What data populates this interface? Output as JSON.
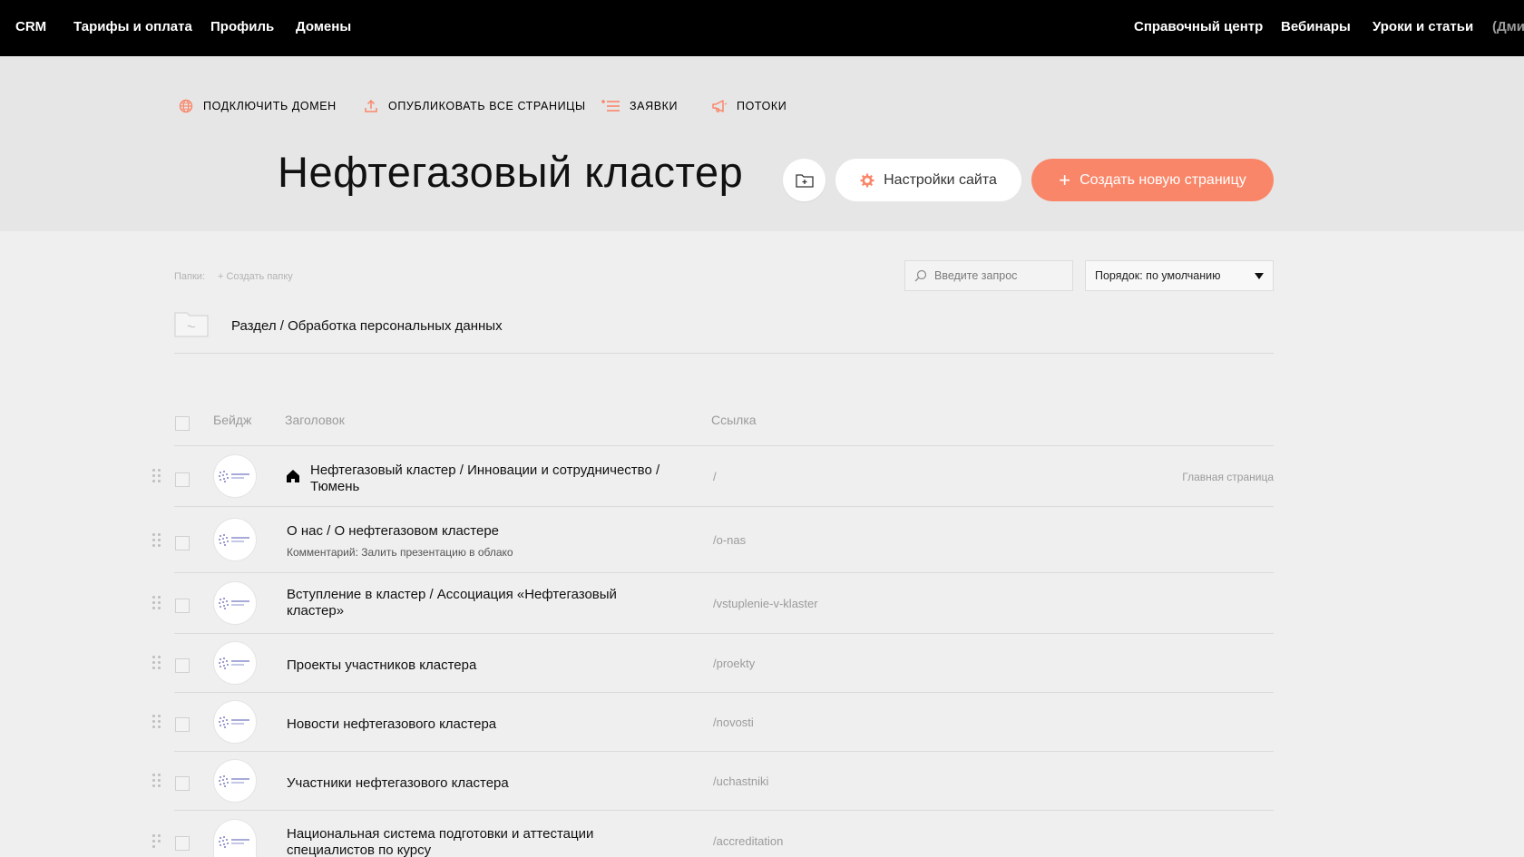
{
  "topnav": {
    "left": [
      "CRM",
      "Тарифы и оплата",
      "Профиль",
      "Домены"
    ],
    "right": [
      "Справочный центр",
      "Вебинары",
      "Уроки и статьи",
      "(Дми"
    ]
  },
  "toolbar": {
    "connect_domain": "Подключить домен",
    "publish_all": "Опубликовать все страницы",
    "requests": "Заявки",
    "streams": "Потоки"
  },
  "site": {
    "title": "Нефтегазовый кластер",
    "settings_label": "Настройки сайта",
    "create_page_label": "Создать новую страницу",
    "create_plus": "+"
  },
  "folders": {
    "label": "Папки:",
    "create_label": "+ Создать папку",
    "items": [
      {
        "name": "Раздел / Обработка персональных данных"
      }
    ]
  },
  "search": {
    "placeholder": "Введите запрос"
  },
  "sort": {
    "label": "Порядок: по умолчанию"
  },
  "table": {
    "headers": {
      "badge": "Бейдж",
      "title": "Заголовок",
      "link": "Ссылка"
    },
    "rows": [
      {
        "title": "Нефтегазовый кластер / Инновации и сотрудничество / Тюмень",
        "link": "/",
        "tag": "Главная страница",
        "home": true
      },
      {
        "title": "О нас / О нефтегазовом кластере",
        "comment": "Комментарий: Залить презентацию в облако",
        "link": "/o-nas"
      },
      {
        "title": "Вступление в кластер / Ассоциация «Нефтегазовый кластер»",
        "link": "/vstuplenie-v-klaster"
      },
      {
        "title": "Проекты участников кластера",
        "link": "/proekty"
      },
      {
        "title": "Новости нефтегазового кластера",
        "link": "/novosti"
      },
      {
        "title": "Участники нефтегазового кластера",
        "link": "/uchastniki"
      },
      {
        "title": "Национальная система подготовки и аттестации специалистов по курсу",
        "link": "/accreditation"
      }
    ]
  },
  "colors": {
    "accent": "#fa8669",
    "topbar": "#000000",
    "header_bg": "#e6e6e6",
    "page_bg": "#efefef"
  },
  "icons": {
    "connect_domain": "globe-icon",
    "publish_all": "upload-icon",
    "requests": "list-icon",
    "streams": "megaphone-icon",
    "folder_button": "folder-add-icon",
    "settings": "gear-icon",
    "search": "search-icon",
    "home": "home-icon",
    "drag": "drag-handle-icon"
  }
}
